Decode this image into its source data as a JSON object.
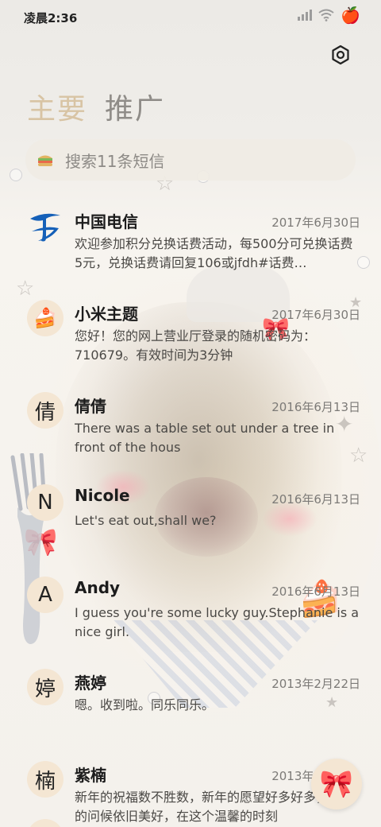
{
  "status_bar": {
    "time": "凌晨2:36",
    "icons": [
      "signal-icon",
      "wifi-icon",
      "apple-icon"
    ]
  },
  "header": {
    "tabs": [
      {
        "label": "主要",
        "active": true
      },
      {
        "label": "推广",
        "active": false
      }
    ],
    "settings_icon": "settings-icon"
  },
  "search": {
    "placeholder": "搜索11条短信",
    "icon": "sandwich-icon"
  },
  "conversations": [
    {
      "avatar_type": "logo",
      "avatar_text": "",
      "name": "中国电信",
      "date": "2017年6月30日",
      "preview": "欢迎参加积分兑换话费活动，每500分可兑换话费5元，兑换话费请回复106或jfdh#话费…"
    },
    {
      "avatar_type": "cake",
      "avatar_text": "",
      "name": "小米主题",
      "date": "2017年6月30日",
      "preview": "您好！您的网上营业厅登录的随机密码为：710679。有效时间为3分钟"
    },
    {
      "avatar_type": "letter",
      "avatar_text": "倩",
      "name": "倩倩",
      "date": "2016年6月13日",
      "preview": "There was a table set out under a tree in front of the hous"
    },
    {
      "avatar_type": "letter",
      "avatar_text": "N",
      "name": "Nicole",
      "date": "2016年6月13日",
      "preview": "Let's eat out,shall we?"
    },
    {
      "avatar_type": "letter",
      "avatar_text": "A",
      "name": "Andy",
      "date": "2016年6月13日",
      "preview": "I guess you're some lucky guy.Stephanie is a nice girl."
    },
    {
      "avatar_type": "letter",
      "avatar_text": "婷",
      "name": "燕婷",
      "date": "2013年2月22日",
      "preview": "嗯。收到啦。同乐同乐。"
    },
    {
      "avatar_type": "letter",
      "avatar_text": "楠",
      "name": "紫楠",
      "date": "2013年2月22日",
      "preview": "新年的祝福数不胜数，新年的愿望好多好多，新年的问候依旧美好，在这个温馨的时刻"
    }
  ],
  "fab": {
    "icon": "bow-icon"
  },
  "colors": {
    "accent_tab": "#d8c4a4",
    "inactive_tab": "#8f8c88",
    "avatar_bg": "#f4e6d3",
    "telecom_blue": "#1560b8"
  }
}
